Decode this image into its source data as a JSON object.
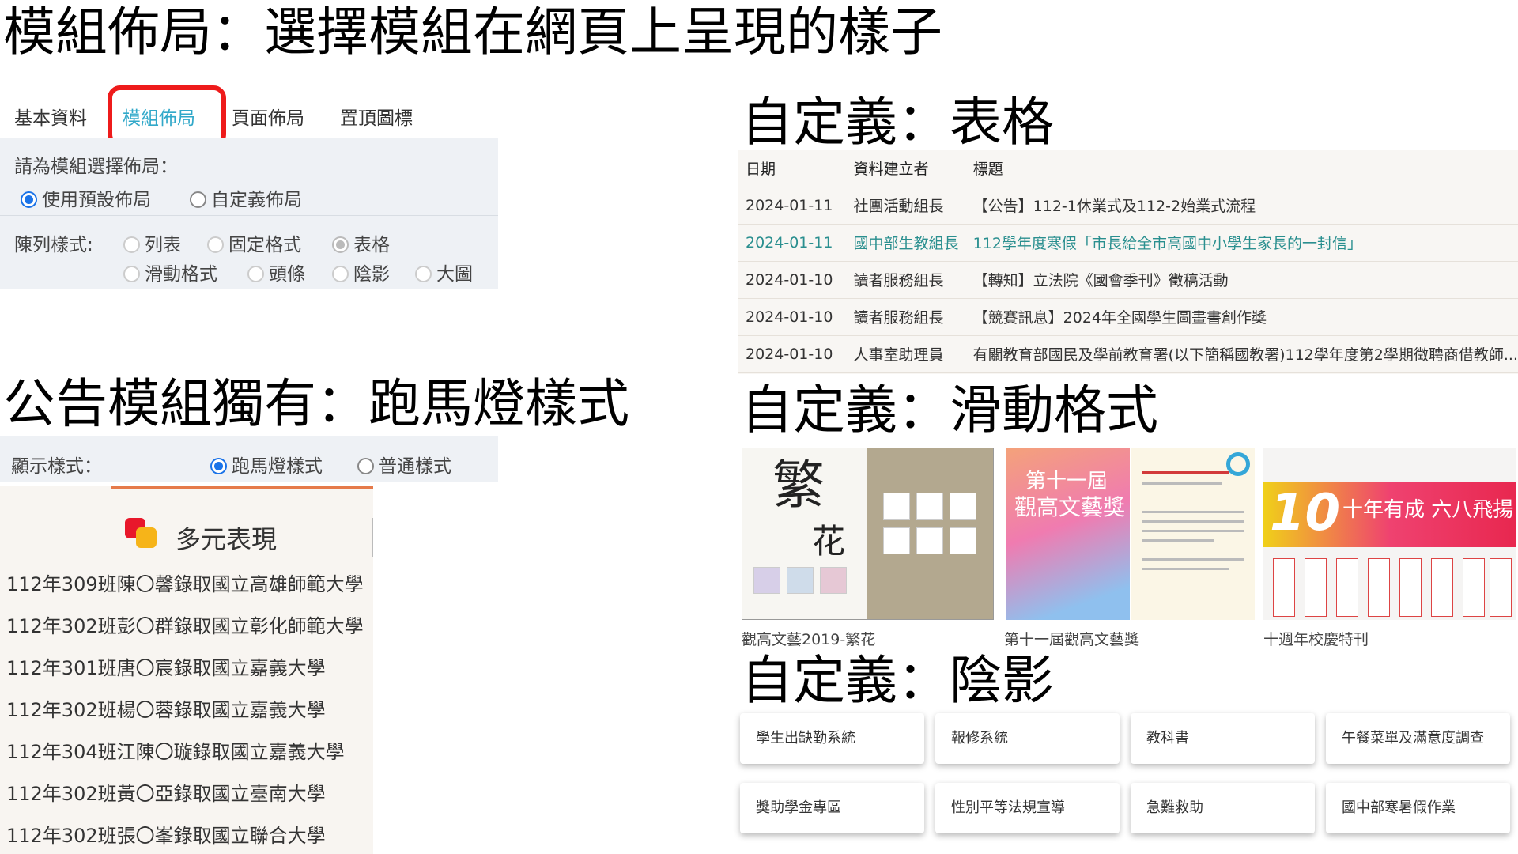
{
  "titles": {
    "layout": "模組佈局：選擇模組在網頁上呈現的樣子",
    "table": "自定義：表格",
    "marquee": "公告模組獨有：跑馬燈樣式",
    "slider": "自定義：滑動格式",
    "shadow": "自定義：陰影"
  },
  "tabs": [
    "基本資料",
    "模組佈局",
    "頁面佈局",
    "置頂圖標"
  ],
  "active_tab_index": 1,
  "highlight_color": "#ee1b1b",
  "layout_settings": {
    "prompt": "請為模組選擇佈局：",
    "mode_options": [
      "使用預設佈局",
      "自定義佈局"
    ],
    "mode_selected": "使用預設佈局",
    "style_label": "陳列樣式:",
    "style_options": [
      "列表",
      "固定格式",
      "表格",
      "滑動格式",
      "頭條",
      "陰影",
      "大圖"
    ],
    "style_selected": "表格"
  },
  "display_setting": {
    "label": "顯示樣式：",
    "options": [
      "跑馬燈樣式",
      "普通樣式"
    ],
    "selected": "跑馬燈樣式"
  },
  "announcements": {
    "title": "多元表現",
    "items": [
      "112年309班陳〇馨錄取國立高雄師範大學",
      "112年302班彭〇群錄取國立彰化師範大學",
      "112年301班唐〇宸錄取國立嘉義大學",
      "112年302班楊〇蓉錄取國立嘉義大學",
      "112年304班江陳〇璇錄取國立嘉義大學",
      "112年302班黃〇亞錄取國立臺南大學",
      "112年302班張〇峯錄取國立聯合大學"
    ]
  },
  "table": {
    "headers": [
      "日期",
      "資料建立者",
      "標題"
    ],
    "rows": [
      [
        "2024-01-11",
        "社團活動組長",
        "【公告】112-1休業式及112-2始業式流程"
      ],
      [
        "2024-01-11",
        "國中部生教組長",
        "112學年度寒假「市長給全市高國中小學生家長的一封信」"
      ],
      [
        "2024-01-10",
        "讀者服務組長",
        "【轉知】立法院《國會季刊》徵稿活動"
      ],
      [
        "2024-01-10",
        "讀者服務組長",
        "【競賽訊息】2024年全國學生圖畫書創作獎"
      ],
      [
        "2024-01-10",
        "人事室助理員",
        "有關教育部國民及學前教育署(以下簡稱國教署)112學年度第2學期徵聘商借教師..."
      ]
    ],
    "highlight_row": 1
  },
  "slider": {
    "slides": [
      {
        "caption": "觀高文藝2019-繁花",
        "art_text": [
          "繁",
          "花"
        ]
      },
      {
        "caption": "第十一屆觀高文藝獎",
        "art_text": [
          "第十一屆",
          "觀高文藝獎"
        ]
      },
      {
        "caption": "",
        "art_text": []
      },
      {
        "caption": "十週年校慶特刊",
        "art_text": [
          "10",
          "十年有成 六八飛揚"
        ]
      }
    ]
  },
  "shadow_buttons": [
    "學生出缺勤系統",
    "報修系統",
    "教科書",
    "午餐菜單及滿意度調查",
    "獎助學金專區",
    "性別平等法規宣導",
    "急難救助",
    "國中部寒暑假作業"
  ]
}
